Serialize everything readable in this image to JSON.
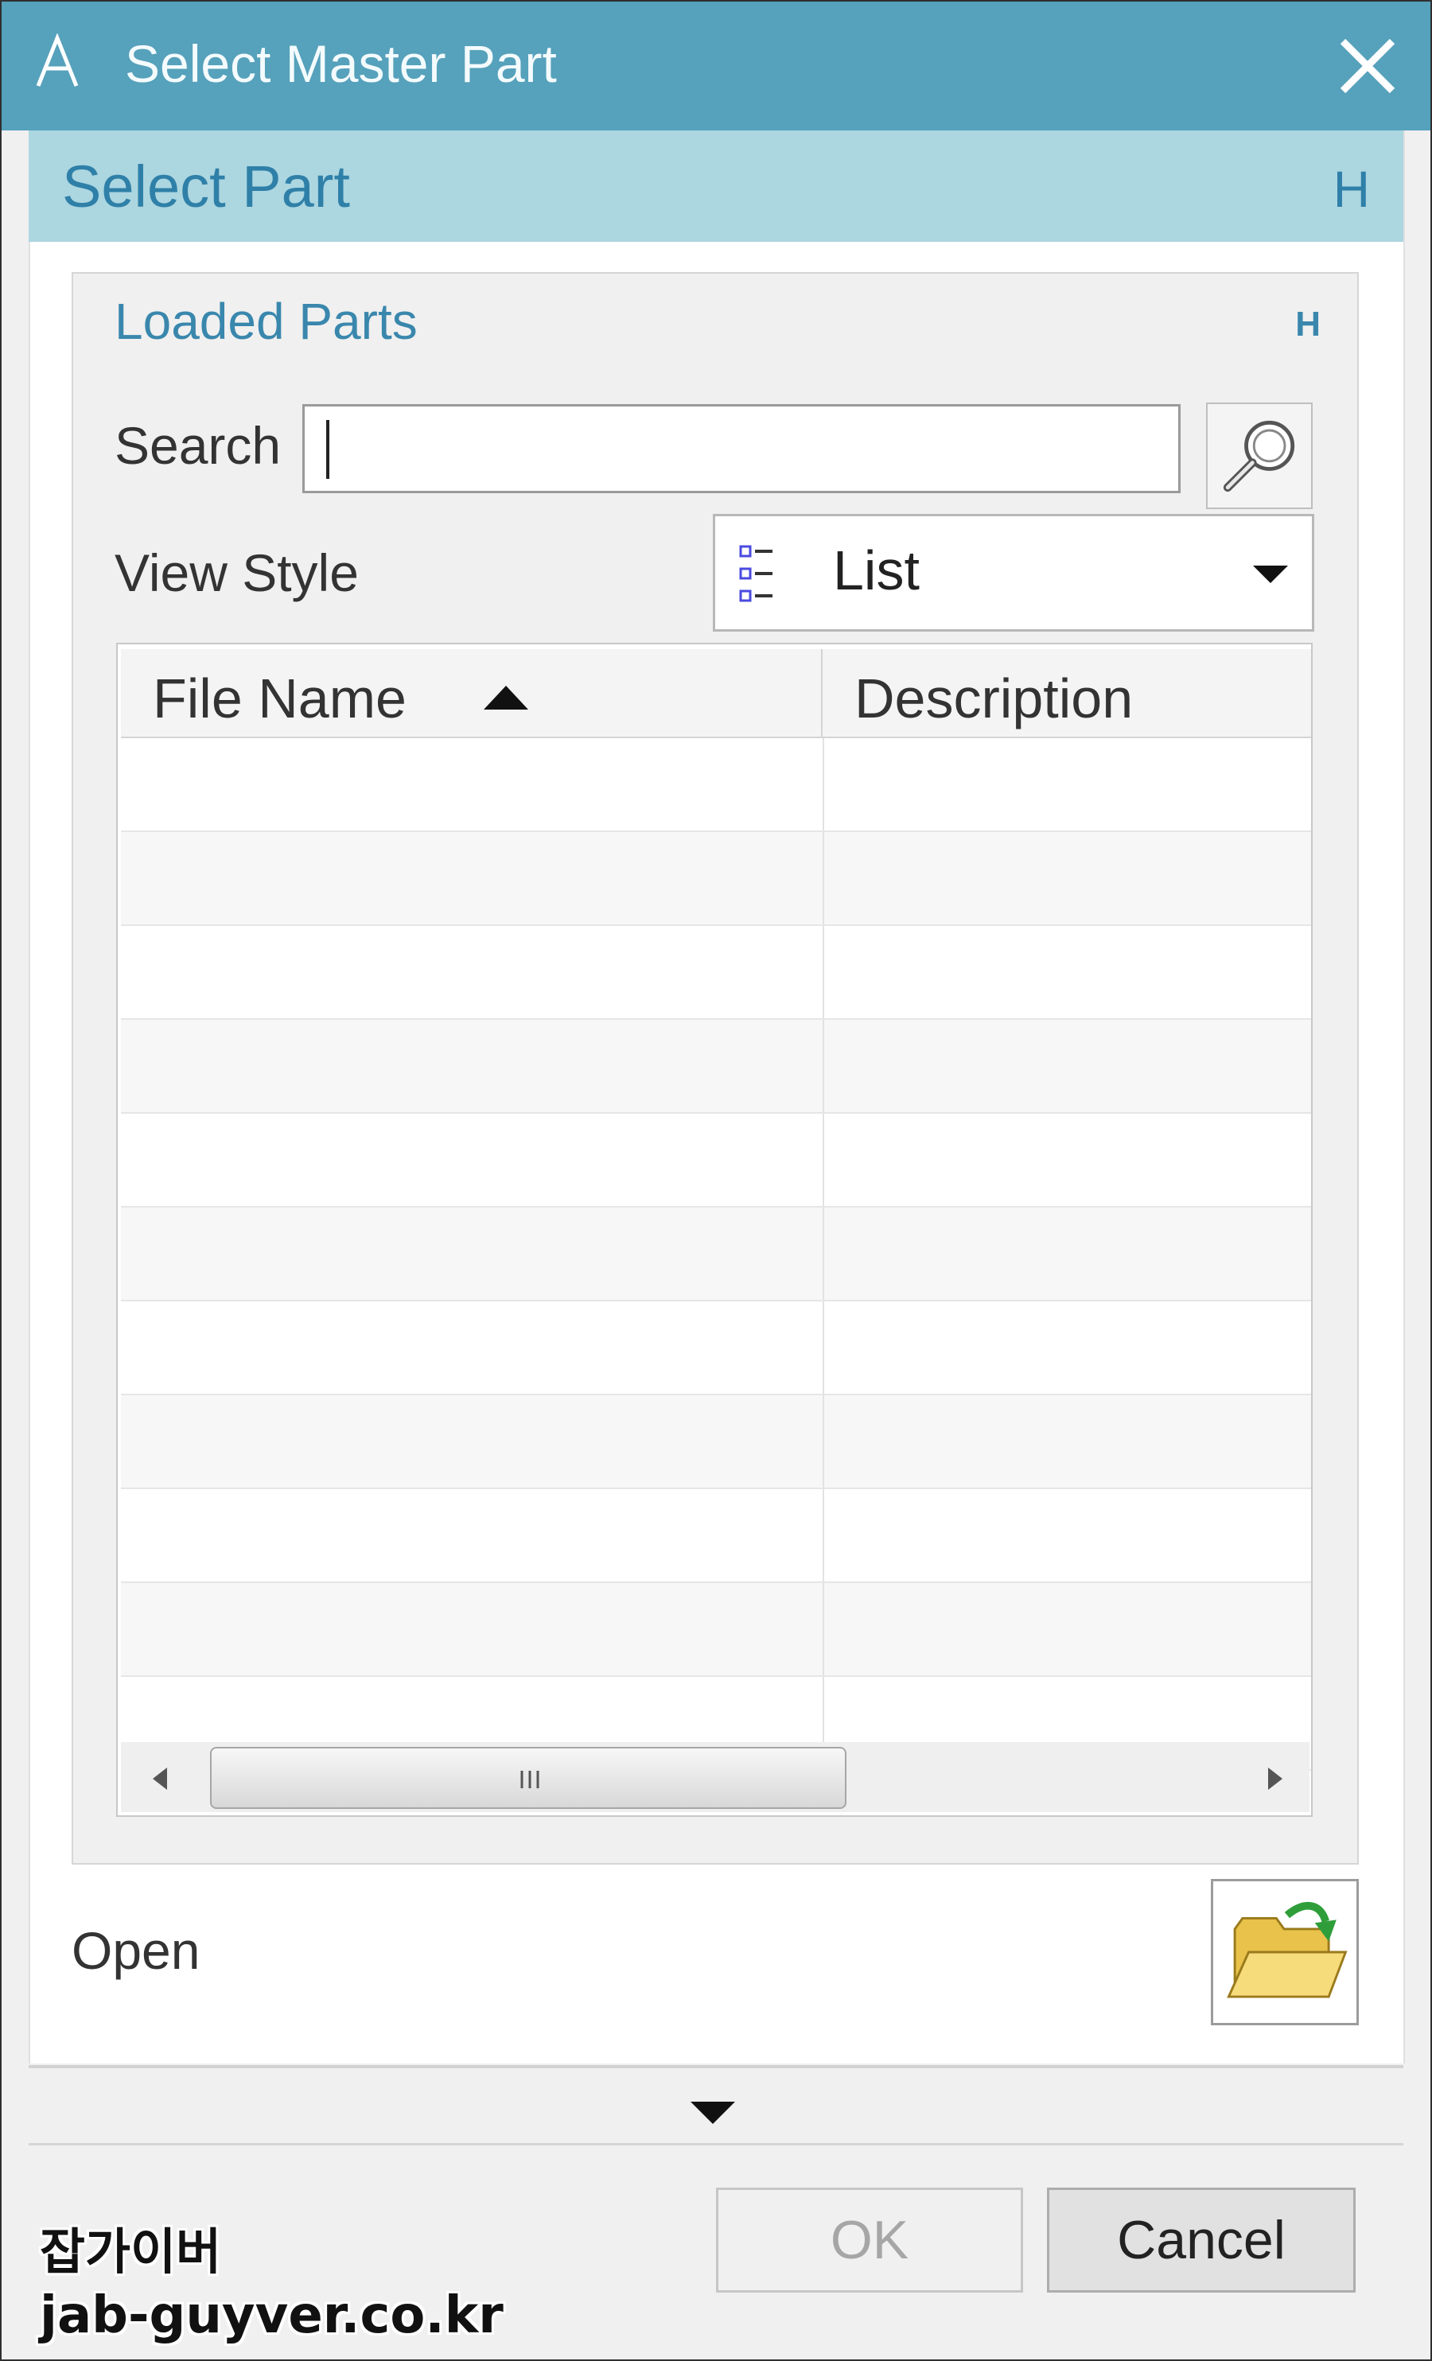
{
  "window": {
    "title": "Select Master Part",
    "app_icon": "nx-a-icon",
    "close_icon": "close-icon",
    "title_bar_color": "#56a1bb"
  },
  "section": {
    "title": "Select Part",
    "collapse_marker": "H",
    "header_color": "#acd6e0"
  },
  "group": {
    "title": "Loaded Parts",
    "collapse_marker": "H",
    "search_label": "Search",
    "search_value": "",
    "search_icon": "magnifier-icon",
    "view_style_label": "View Style",
    "view_style_value": "List",
    "view_style_icon": "list-view-icon"
  },
  "table": {
    "columns": [
      "File Name",
      "Description"
    ],
    "sort_column": "File Name",
    "sort_direction": "ascending",
    "rows": []
  },
  "open": {
    "label": "Open",
    "icon": "open-folder-icon"
  },
  "footer": {
    "expand_icon": "chevron-down-icon",
    "ok_label": "OK",
    "ok_enabled": false,
    "cancel_label": "Cancel"
  },
  "watermark": {
    "line1": "잡가이버",
    "line2": "jab-guyver.co.kr"
  }
}
